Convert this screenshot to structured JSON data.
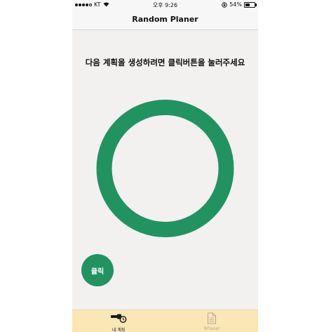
{
  "status_bar": {
    "carrier": "KT",
    "time": "오후 9:26",
    "battery_text": "54%",
    "battery_level": 0.54,
    "icons": [
      "wifi-icon",
      "rotation-lock-icon",
      "battery-icon"
    ]
  },
  "nav": {
    "title": "Random Planer"
  },
  "main": {
    "instruction": "다음 계획을 생성하려면 클릭버튼을 눌러주세요",
    "click_label": "클릭"
  },
  "tabs": [
    {
      "label": "내 계획",
      "icon": "plan-icon",
      "selected": true
    },
    {
      "label": "RPlaner",
      "icon": "document-icon",
      "selected": false
    }
  ],
  "colors": {
    "accent": "#229261",
    "background": "#f2f1ef",
    "tab_bar": "#fbe6b6"
  }
}
